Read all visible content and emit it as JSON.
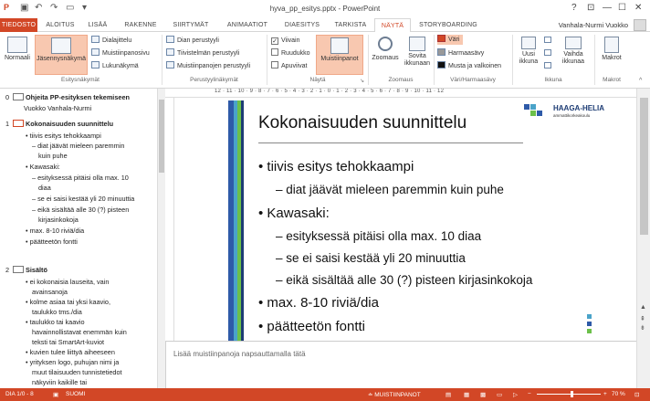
{
  "titlebar": {
    "title": "hyva_pp_esitys.pptx - PowerPoint",
    "help": "?",
    "restore": "⊡",
    "minimize": "—",
    "maximize": "☐",
    "close": "✕"
  },
  "tabs": [
    "TIEDOSTO",
    "ALOITUS",
    "LISÄÄ",
    "RAKENNE",
    "SIIRTYMÄT",
    "ANIMAATIOT",
    "DIAESITYS",
    "TARKISTA",
    "NÄYTÄ",
    "STORYBOARDING"
  ],
  "active_tab": "NÄYTÄ",
  "account": "Vanhala-Nurmi Vuokko",
  "ribbon": {
    "esitysnakymat": {
      "label": "Esitysnäkymät",
      "normaali": "Normaali",
      "jasennys": "Jäsennysnäkymä",
      "dialajittelu": "Dialajittelu",
      "muistiinpanosivu": "Muistiinpanosivu",
      "lukunakyma": "Lukunäkymä"
    },
    "perustyylinakymat": {
      "label": "Perustyylinäkymät",
      "dian": "Dian perustyyli",
      "tiivistelma": "Tiivistelmän perustyyli",
      "muistiinpanojen": "Muistiinpanojen perustyyli"
    },
    "nayta": {
      "label": "Näytä",
      "viivain": "Viivain",
      "ruudukko": "Ruudukko",
      "apuviivat": "Apuviivat",
      "muistiinpanot": "Muistiinpanot",
      "viivain_checked": "✓"
    },
    "zoomaus": {
      "label": "Zoomaus",
      "zoomaus": "Zoomaus",
      "sovita1": "Sovita",
      "sovita2": "ikkunaan"
    },
    "vari": {
      "label": "Väri/Harmaasävy",
      "vari": "Väri",
      "harmaasavy": "Harmaasävy",
      "mustavalko": "Musta ja valkoinen"
    },
    "ikkuna": {
      "label": "Ikkuna",
      "uusi1": "Uusi",
      "uusi2": "ikkuna",
      "vaihda1": "Vaihda",
      "vaihda2": "ikkunaa"
    },
    "makrot": {
      "label": "Makrot",
      "makrot": "Makrot"
    }
  },
  "outline": {
    "slides": [
      {
        "num": "0",
        "title": "Ohjeita PP-esityksen tekemiseen",
        "lines": [
          "Vuokko Vanhala-Nurmi"
        ]
      },
      {
        "num": "1",
        "title": "Kokonaisuuden suunnittelu",
        "lines": [
          "• tiivis esitys tehokkaampi",
          "– diat jäävät mieleen paremmin",
          "kuin puhe",
          "• Kawasaki:",
          "– esityksessä pitäisi olla max. 10",
          "diaa",
          "– se ei saisi kestää yli 20 minuuttia",
          "– eikä sisältää alle 30 (?) pisteen",
          "kirjasinkokoja",
          "• max. 8-10 riviä/dia",
          "• päätteetön fontti"
        ]
      },
      {
        "num": "2",
        "title": "Sisältö",
        "lines": [
          "• ei kokonaisia lauseita, vain",
          "avainsanoja",
          "• kolme asiaa tai yksi kaavio,",
          "taulukko tms./dia",
          "• taulukko tai kaavio",
          "havainnollistavat enemmän kuin",
          "teksti tai SmartArt-kuviot",
          "• kuvien tulee liittyä aiheeseen",
          "• yrityksen logo, puhujan nimi ja",
          "muut tilaisuuden tunnistetiedot",
          "näkyviin kaikille tai"
        ]
      }
    ]
  },
  "ruler_text": "12 · 11 · 10 · 9 · 8 · 7 · 6 · 5 · 4 · 3 · 2 · 1 · 0 · 1 · 2 · 3 · 4 · 5 · 6 · 7 · 8 · 9 · 10 · 11 · 12",
  "slide": {
    "title": "Kokonaisuuden suunnittelu",
    "logo_text": "HAAGA-HELIA",
    "logo_sub": "ammattikorkeakoulu",
    "bullets": [
      "• tiivis esitys tehokkaampi",
      "– diat jäävät mieleen paremmin kuin puhe",
      "• Kawasaki:",
      "– esityksessä pitäisi olla max. 10 diaa",
      "– se ei saisi kestää yli 20 minuuttia",
      "– eikä sisältää alle 30 (?) pisteen kirjasinkokoja",
      "• max. 8-10 riviä/dia",
      "• päätteetön fontti"
    ]
  },
  "notes_placeholder": "Lisää muistiinpanoja napsauttamalla tätä",
  "status": {
    "slide": "DIA 1/0 - 8",
    "language": "SUOMI",
    "notes": "≐ MUISTIINPANOT",
    "zoom": "70 %"
  },
  "colors": {
    "accent": "#d24726",
    "selected": "#f8c8b0"
  }
}
